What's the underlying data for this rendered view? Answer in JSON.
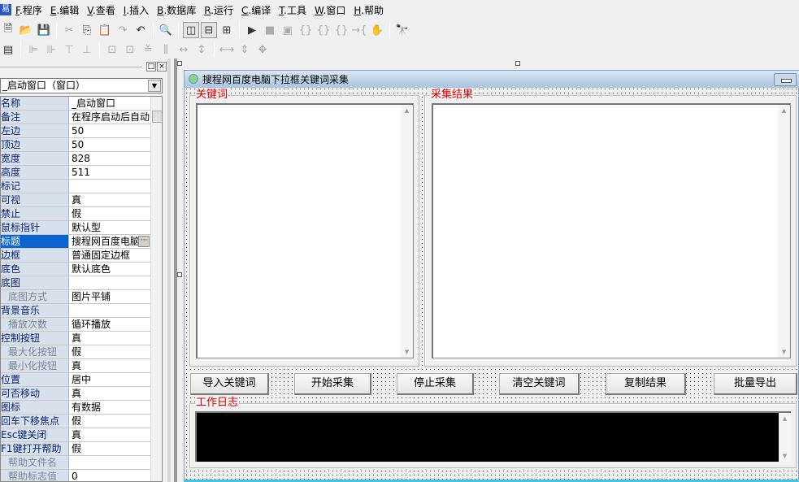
{
  "menu": [
    {
      "key": "F",
      "label": "程序"
    },
    {
      "key": "E",
      "label": "编辑"
    },
    {
      "key": "V",
      "label": "查看"
    },
    {
      "key": "I",
      "label": "插入"
    },
    {
      "key": "B",
      "label": "数据库"
    },
    {
      "key": "R",
      "label": "运行"
    },
    {
      "key": "C",
      "label": "编译"
    },
    {
      "key": "T",
      "label": "工具"
    },
    {
      "key": "W",
      "label": "窗口"
    },
    {
      "key": "H",
      "label": "帮助"
    }
  ],
  "panel": {
    "restore": "□",
    "close": "×",
    "combo": "_启动窗口（窗口）"
  },
  "properties": [
    {
      "name": "名称",
      "value": "_启动窗口"
    },
    {
      "name": "备注",
      "value": "在程序启动后自动"
    },
    {
      "name": "左边",
      "value": "50"
    },
    {
      "name": "顶边",
      "value": "50"
    },
    {
      "name": "宽度",
      "value": "828"
    },
    {
      "name": "高度",
      "value": "511"
    },
    {
      "name": "标记",
      "value": ""
    },
    {
      "name": "可视",
      "value": "真"
    },
    {
      "name": "禁止",
      "value": "假"
    },
    {
      "name": "鼠标指针",
      "value": "默认型"
    },
    {
      "name": "标题",
      "value": "搜程网百度电脑",
      "selected": true
    },
    {
      "name": "边框",
      "value": "普通固定边框"
    },
    {
      "name": "底色",
      "value": "默认底色"
    },
    {
      "name": "底图",
      "value": ""
    },
    {
      "name": "底图方式",
      "value": "图片平铺",
      "sub": true
    },
    {
      "name": "背景音乐",
      "value": ""
    },
    {
      "name": "播放次数",
      "value": "循环播放",
      "sub": true
    },
    {
      "name": "控制按钮",
      "value": "真"
    },
    {
      "name": "最大化按钮",
      "value": "假",
      "sub": true
    },
    {
      "name": "最小化按钮",
      "value": "真",
      "sub": true
    },
    {
      "name": "位置",
      "value": "居中"
    },
    {
      "name": "可否移动",
      "value": "真"
    },
    {
      "name": "图标",
      "value": "有数据"
    },
    {
      "name": "回车下移焦点",
      "value": "假"
    },
    {
      "name": "Esc键关闭",
      "value": "真"
    },
    {
      "name": "F1键打开帮助",
      "value": "假"
    },
    {
      "name": "帮助文件名",
      "value": "",
      "sub": true
    },
    {
      "name": "帮助标志值",
      "value": "0",
      "sub": true
    }
  ],
  "form": {
    "title": "搜程网百度电脑下拉框关键词采集",
    "keywords_group": "关键词",
    "results_group": "采集结果",
    "log_group": "工作日志",
    "buttons": [
      "导入关键词",
      "开始采集",
      "停止采集",
      "清空关键词",
      "复制结果",
      "批量导出"
    ]
  },
  "colors": {
    "group_title": "#e00000",
    "selected_row": "#0a64d2",
    "log_bg": "#000000"
  }
}
